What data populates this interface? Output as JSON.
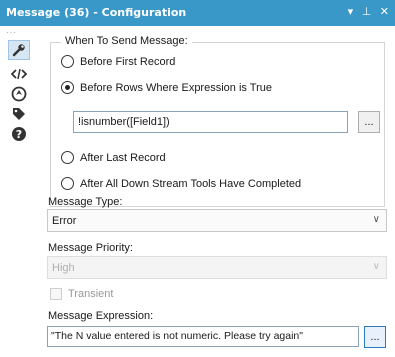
{
  "window": {
    "title": "Message (36) - Configuration",
    "controls": [
      "▾",
      "⊥",
      "✕"
    ]
  },
  "toolbar": {
    "tools": [
      {
        "icon": "wrench-icon"
      },
      {
        "icon": "code-icon"
      },
      {
        "icon": "navigate-icon"
      },
      {
        "icon": "tag-icon"
      },
      {
        "icon": "help-icon"
      }
    ]
  },
  "when_to_send": {
    "legend": "When To Send Message:",
    "options": [
      {
        "label": "Before First Record",
        "checked": false
      },
      {
        "label": "Before Rows Where Expression is True",
        "checked": true
      },
      {
        "label": "After Last Record",
        "checked": false
      },
      {
        "label": "After All Down Stream Tools Have Completed",
        "checked": false
      }
    ],
    "expression_value": "!isnumber([Field1])",
    "expression_button": "..."
  },
  "message_type": {
    "label": "Message Type:",
    "value": "Error"
  },
  "message_priority": {
    "label": "Message Priority:",
    "value": "High",
    "disabled": true
  },
  "transient": {
    "label": "Transient",
    "checked": false,
    "disabled": true
  },
  "message_expression": {
    "label": "Message Expression:",
    "value": "\"The N value entered is not numeric. Please try again\"",
    "button": "..."
  },
  "colors": {
    "titlebar": "#3a98c8",
    "accent": "#2b78c4"
  }
}
